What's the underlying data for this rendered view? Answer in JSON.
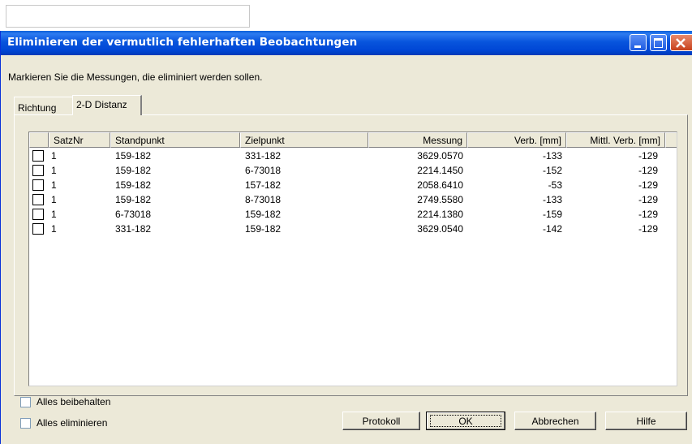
{
  "window": {
    "title": "Eliminieren der vermutlich fehlerhaften Beobachtungen",
    "controls": [
      "minimize-icon",
      "maximize-icon",
      "close-icon"
    ]
  },
  "instruction": "Markieren Sie die Messungen, die eliminiert werden sollen.",
  "tabs": [
    {
      "label": "Richtung",
      "active": false
    },
    {
      "label": "2-D Distanz",
      "active": true
    }
  ],
  "table": {
    "columns": [
      "SatzNr",
      "Standpunkt",
      "Zielpunkt",
      "Messung",
      "Verb. [mm]",
      "Mittl. Verb. [mm]"
    ],
    "rows": [
      {
        "checked": false,
        "satz": "1",
        "standpunkt": "159-182",
        "zielpunkt": "331-182",
        "messung": "3629.0570",
        "verb": "-133",
        "mittl": "-129"
      },
      {
        "checked": false,
        "satz": "1",
        "standpunkt": "159-182",
        "zielpunkt": "6-73018",
        "messung": "2214.1450",
        "verb": "-152",
        "mittl": "-129"
      },
      {
        "checked": false,
        "satz": "1",
        "standpunkt": "159-182",
        "zielpunkt": "157-182",
        "messung": "2058.6410",
        "verb": "-53",
        "mittl": "-129"
      },
      {
        "checked": false,
        "satz": "1",
        "standpunkt": "159-182",
        "zielpunkt": "8-73018",
        "messung": "2749.5580",
        "verb": "-133",
        "mittl": "-129"
      },
      {
        "checked": false,
        "satz": "1",
        "standpunkt": "6-73018",
        "zielpunkt": "159-182",
        "messung": "2214.1380",
        "verb": "-159",
        "mittl": "-129"
      },
      {
        "checked": false,
        "satz": "1",
        "standpunkt": "331-182",
        "zielpunkt": "159-182",
        "messung": "3629.0540",
        "verb": "-142",
        "mittl": "-129"
      }
    ]
  },
  "options": {
    "keep_all": {
      "label": "Alles beibehalten",
      "checked": false
    },
    "eliminate_all": {
      "label": "Alles eliminieren",
      "checked": false
    }
  },
  "buttons": {
    "protokoll": "Protokoll",
    "ok": "OK",
    "abbrechen": "Abbrechen",
    "hilfe": "Hilfe"
  }
}
